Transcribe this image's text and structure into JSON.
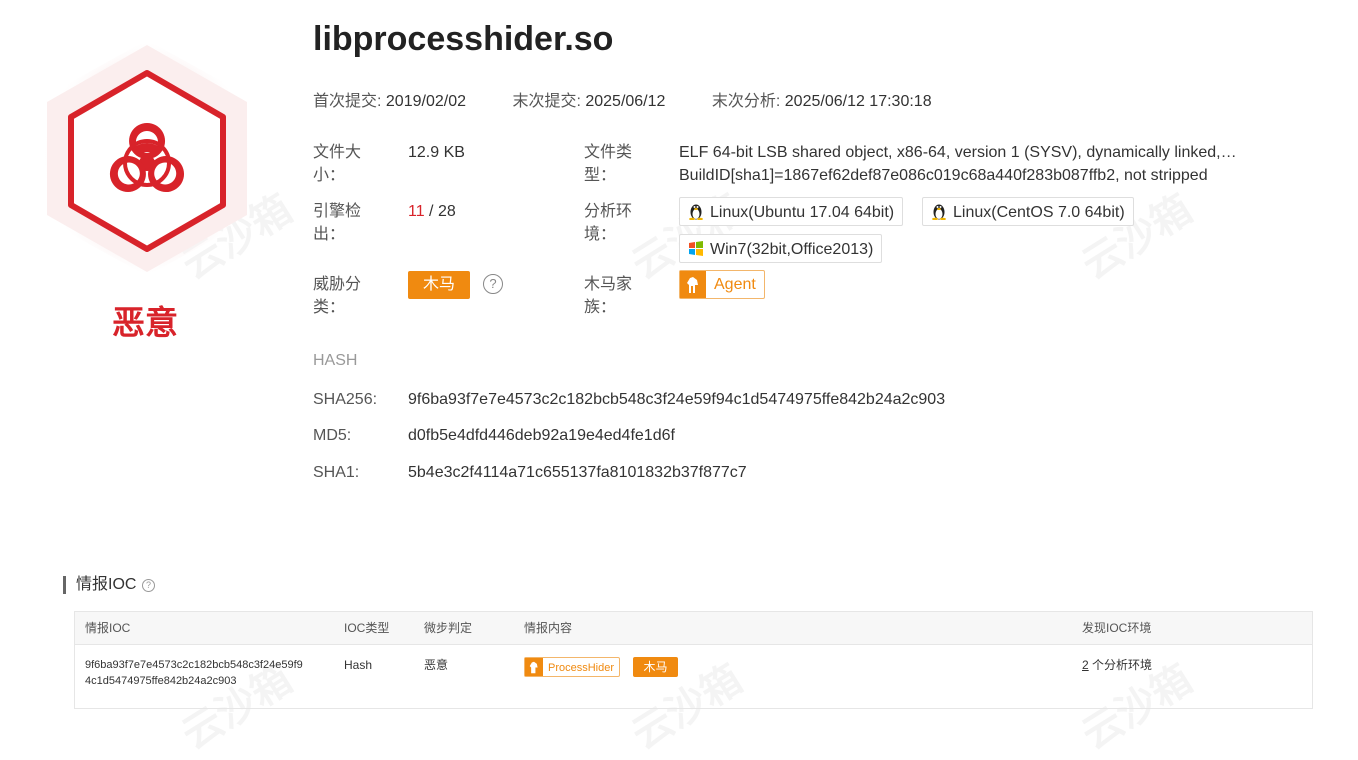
{
  "file": {
    "name": "libprocesshider.so",
    "verdict": "恶意"
  },
  "dates": {
    "first_submit_label": "首次提交:",
    "first_submit_value": "2019/02/02",
    "last_submit_label": "末次提交:",
    "last_submit_value": "2025/06/12",
    "last_analysis_label": "末次分析:",
    "last_analysis_value": "2025/06/12 17:30:18"
  },
  "info": {
    "size_label_1": "文件大",
    "size_label_2": "小：",
    "size_value": "12.9 KB",
    "type_label_1": "文件类",
    "type_label_2": "型：",
    "type_value_line1": "ELF 64-bit LSB shared object, x86-64, version 1 (SYSV), dynamically linked,…",
    "type_value_line2": "BuildID[sha1]=1867ef62def87e086c019c68a440f283b087ffb2, not stripped",
    "engine_label_1": "引擎检",
    "engine_label_2": "出：",
    "engine_detected": "11",
    "engine_total": " / 28",
    "env_label_1": "分析环",
    "env_label_2": "境：",
    "envs": [
      {
        "label": "Linux(Ubuntu 17.04 64bit)",
        "icon": "linux-icon"
      },
      {
        "label": "Linux(CentOS 7.0 64bit)",
        "icon": "linux-icon"
      },
      {
        "label": "Win7(32bit,Office2013)",
        "icon": "windows-icon"
      }
    ],
    "threat_label_1": "威胁分",
    "threat_label_2": "类：",
    "threat_value": "木马",
    "help_glyph": "?",
    "family_label_1": "木马家",
    "family_label_2": "族：",
    "family_value": "Agent"
  },
  "hash": {
    "heading": "HASH",
    "sha256_label": "SHA256:",
    "sha256_value": "9f6ba93f7e7e4573c2c182bcb548c3f24e59f94c1d5474975ffe842b24a2c903",
    "md5_label": "MD5:",
    "md5_value": "d0fb5e4dfd446deb92a19e4ed4fe1d6f",
    "sha1_label": "SHA1:",
    "sha1_value": "5b4e3c2f4114a71c655137fa8101832b37f877c7"
  },
  "ioc": {
    "heading": "情报IOC",
    "help_glyph": "?",
    "columns": [
      "情报IOC",
      "IOC类型",
      "微步判定",
      "情报内容",
      "发现IOC环境"
    ],
    "row": {
      "ioc_line1": "9f6ba93f7e7e4573c2c182bcb548c3f24e59f9",
      "ioc_line2": "4c1d5474975ffe842b24a2c903",
      "type": "Hash",
      "verdict": "恶意",
      "tag_family": "ProcessHider",
      "tag_type": "木马",
      "env_count": "2",
      "env_suffix": " 个分析环境"
    }
  },
  "watermark": "云沙箱",
  "colors": {
    "malicious_red": "#d8232a",
    "orange": "#f08a10"
  }
}
